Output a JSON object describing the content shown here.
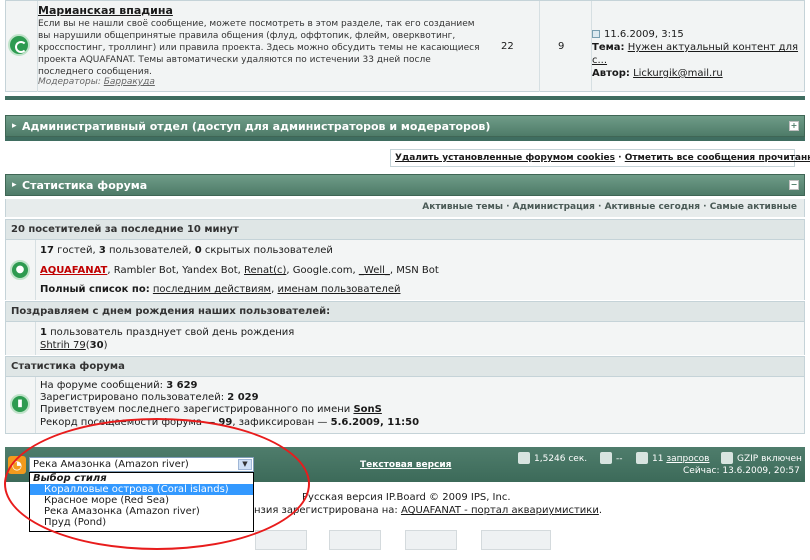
{
  "forum": {
    "title": "Марианская впадина",
    "desc": "Если вы не нашли своё сообщение, можете посмотреть в этом разделе, так его созданием вы нарушили общепринятые правила общения (флуд, оффтопик, флейм, оверквотинг, кросспостинг, троллинг) или правила проекта. Здесь можно обсудить темы не касающиеся проекта AQUAFANAT. Темы автоматически удаляются по истечении 33 дней после последнего сообщения.",
    "mods_label": "Модераторы:",
    "mods_name": "Барракуда",
    "topics": "22",
    "replies": "9",
    "last_date": "11.6.2009, 3:15",
    "last_topic_label": "Тема:",
    "last_topic": "Нужен актуальный контент для с...",
    "last_author_label": "Автор:",
    "last_author": "Lickurgik@mail.ru"
  },
  "admin_category": "Административный отдел (доступ для администраторов и модераторов)",
  "cookies": {
    "delete": "Удалить установленные форумом cookies",
    "sep": " · ",
    "mark_read": "Отметить все сообщения прочитанными"
  },
  "stats": {
    "title": "Статистика форума",
    "nav": "Активные темы · Администрация · Активные сегодня · Самые активные",
    "visitors_head": "20 посетителей за последние 10 минут",
    "guests": "17",
    "guests_txt": " гостей, ",
    "users": "3",
    "users_txt": " пользователей, ",
    "hidden": "0",
    "hidden_txt": " скрытых пользователей",
    "online": [
      "AQUAFANAT",
      ", Rambler Bot, Yandex Bot, ",
      "Renat(c)",
      ", Google.com, ",
      "_Well_",
      ", MSN Bot"
    ],
    "full_list_label": "Полный список по:",
    "full_list_a": "последним действиям",
    "full_list_sep": ", ",
    "full_list_b": "именам пользователей",
    "bday_head": "Поздравляем с днем рождения наших пользователей:",
    "bday_count": "1",
    "bday_txt": " пользователь празднует свой день рождения",
    "bday_user": "Shtrih 79",
    "bday_age_open": "(",
    "bday_age": "30",
    "bday_age_close": ")",
    "sub_head": "Статистика форума",
    "posts_label": "На форуме сообщений: ",
    "posts": "3 629",
    "reg_label": "Зарегистрировано пользователей: ",
    "reg": "2 029",
    "newest_label": "Приветствуем последнего зарегистрированного по имени ",
    "newest": "SonS",
    "record_label": "Рекорд посещаемости форума — ",
    "record": "99",
    "record_mid": ", зафиксирован — ",
    "record_date": "5.6.2009, 11:50"
  },
  "bottom": {
    "style_selected": "Река Амазонка (Amazon river)",
    "style_group": "Выбор стиля",
    "style_options": [
      "Коралловые острова (Coral islands)",
      "Красное море (Red Sea)",
      "Река Амазонка (Amazon river)",
      "Пруд (Pond)"
    ],
    "text_version": "Текстовая версия",
    "time": "1,5246 сек.",
    "dash": "--",
    "queries": "11 ",
    "queries_link": "запросов",
    "gzip": "GZIP включен",
    "now": "Сейчас: 13.6.2009, 20:57"
  },
  "footer": {
    "line1": "Русская версия IP.Board © 2009  IPS, Inc.",
    "line2_pre": "нзия зарегистрирована на: ",
    "line2_link": "AQUAFANAT - портал аквариумистики",
    "line2_post": "."
  },
  "colors": {
    "header_green": "#4e7b68",
    "highlight": "#3399ff",
    "rss": "#f29a1d",
    "annotation": "#e81c1c"
  }
}
